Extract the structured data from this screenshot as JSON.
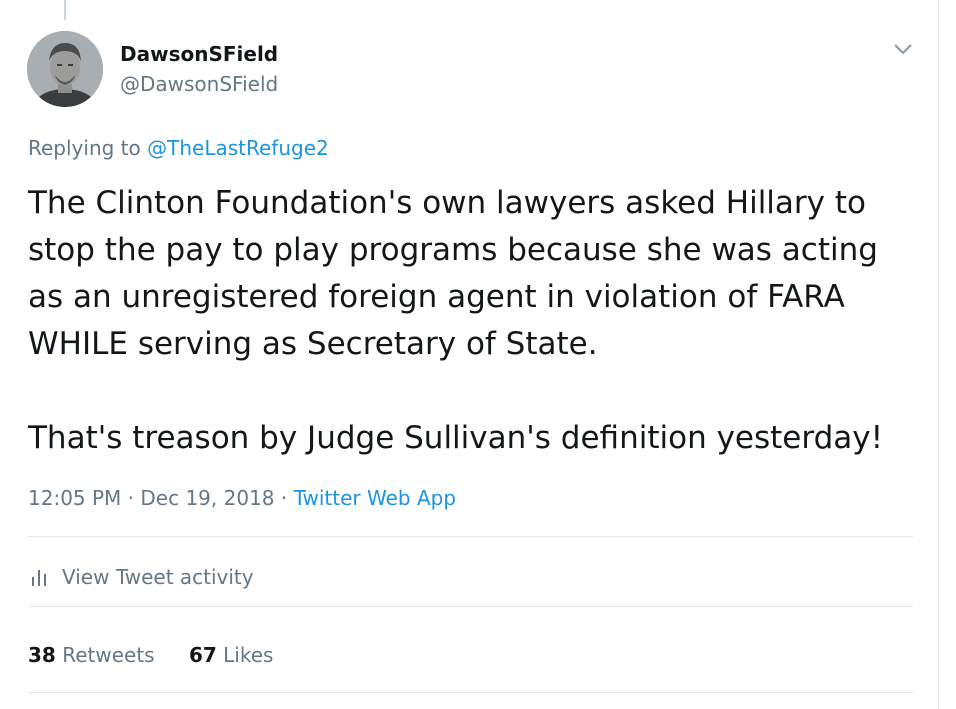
{
  "user": {
    "display_name": "DawsonSField",
    "handle": "@DawsonSField"
  },
  "reply": {
    "prefix": "Replying to",
    "mention": "@TheLastRefuge2"
  },
  "tweet": {
    "text": "The Clinton Foundation's own lawyers asked Hillary to stop the pay to play programs because she was acting as an unregistered foreign agent in violation of FARA WHILE serving as Secretary of State.\n\nThat's treason by Judge Sullivan's definition yesterday!",
    "time": "12:05 PM",
    "date": "Dec 19, 2018",
    "source": "Twitter Web App",
    "separator": "·"
  },
  "activity": {
    "label": "View Tweet activity",
    "icon": "bar-chart-icon"
  },
  "stats": {
    "retweets_count": "38",
    "retweets_label": "Retweets",
    "likes_count": "67",
    "likes_label": "Likes"
  },
  "colors": {
    "link": "#1b95e0",
    "secondary": "#657786",
    "primary": "#14171a",
    "divider": "#e1e8ed"
  }
}
